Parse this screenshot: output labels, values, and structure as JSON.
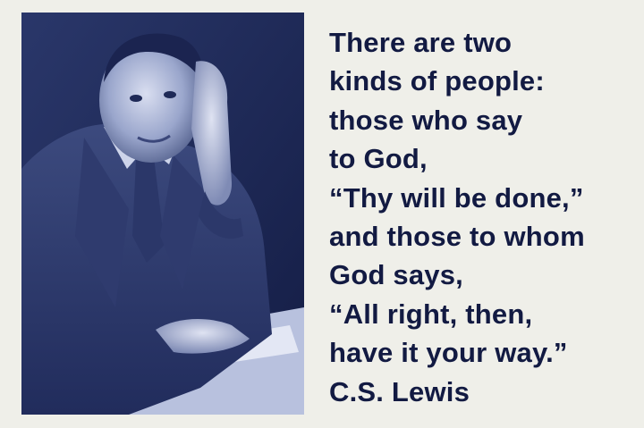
{
  "quote": {
    "lines": [
      "There are two",
      "kinds of people:",
      "those who say",
      "to God,",
      "“Thy will be done,”",
      "and those to whom",
      "God says,",
      "“All right, then,",
      "have it your way.”"
    ],
    "author": "C.S. Lewis"
  },
  "colors": {
    "background": "#efefe9",
    "text": "#121a42",
    "photo_dark": "#1d2a5c",
    "photo_light": "#c7cfe6"
  }
}
